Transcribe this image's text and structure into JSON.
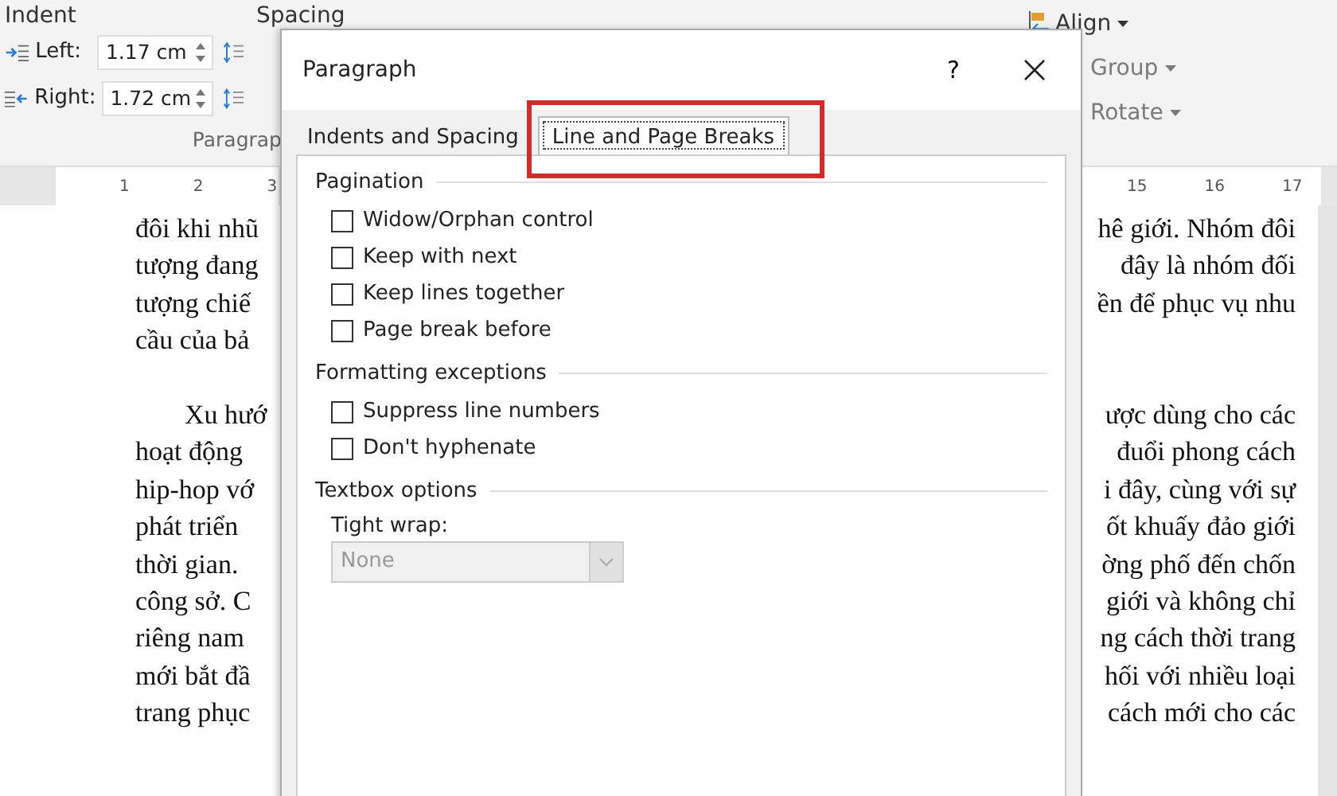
{
  "ribbon": {
    "indent_label": "Indent",
    "spacing_label": "Spacing",
    "indent_fields": [
      {
        "kind": "left",
        "label": "Left:",
        "value": "1.17 cm"
      },
      {
        "kind": "right",
        "label": "Right:",
        "value": "1.72 cm"
      }
    ],
    "group_label": "Paragrap",
    "arrange": [
      {
        "label": "Align",
        "disabled": false
      },
      {
        "label": "Group",
        "disabled": true
      },
      {
        "label": "Rotate",
        "disabled": true
      }
    ]
  },
  "ruler": {
    "left_ticks": [
      "1",
      "2",
      "3"
    ],
    "right_ticks": [
      "15",
      "16",
      "17"
    ]
  },
  "document": {
    "paragraphs": [
      {
        "lines": [
          {
            "left": "đôi khi nhũ",
            "right": "hê giới. Nhóm đôi"
          },
          {
            "left": "tượng đang",
            "right": "đây là nhóm đối"
          },
          {
            "left": "tượng chiế",
            "right": "ền để phục vụ nhu"
          },
          {
            "left": "cầu của bả"
          }
        ]
      },
      {
        "lines": [
          {
            "left": "Xu hướ",
            "right": "ược dùng cho các"
          },
          {
            "left": "hoạt động",
            "right": "đuổi phong cách"
          },
          {
            "left": "hip-hop vớ",
            "right": "i đây, cùng với sự"
          },
          {
            "left": "phát triển",
            "right": "ốt khuấy đảo giới"
          },
          {
            "left": "thời gian.",
            "right": "ờng phố đến chốn"
          },
          {
            "left": "công sở. C",
            "right": "giới và không chỉ"
          },
          {
            "left": "riêng nam",
            "right": "ng cách thời trang"
          },
          {
            "left": "mới bắt đầ",
            "right": "hối với nhiều loại"
          },
          {
            "left": "trang phục",
            "right": "cách mới cho các"
          }
        ]
      }
    ]
  },
  "dialog": {
    "title": "Paragraph",
    "help": "?",
    "tabs": [
      {
        "label": "Indents and Spacing",
        "selected": false,
        "highlighted": false
      },
      {
        "label": "Line and Page Breaks",
        "selected": true,
        "highlighted": true
      }
    ],
    "sections": [
      {
        "heading": "Pagination",
        "options": [
          {
            "label": "Widow/Orphan control",
            "checked": false
          },
          {
            "label": "Keep with next",
            "checked": false
          },
          {
            "label": "Keep lines together",
            "checked": false
          },
          {
            "label": "Page break before",
            "checked": false
          }
        ]
      },
      {
        "heading": "Formatting exceptions",
        "options": [
          {
            "label": "Suppress line numbers",
            "checked": false
          },
          {
            "label": "Don't hyphenate",
            "checked": false
          }
        ]
      },
      {
        "heading": "Textbox options",
        "select": {
          "label": "Tight wrap:",
          "value": "None",
          "disabled": true
        }
      }
    ]
  }
}
